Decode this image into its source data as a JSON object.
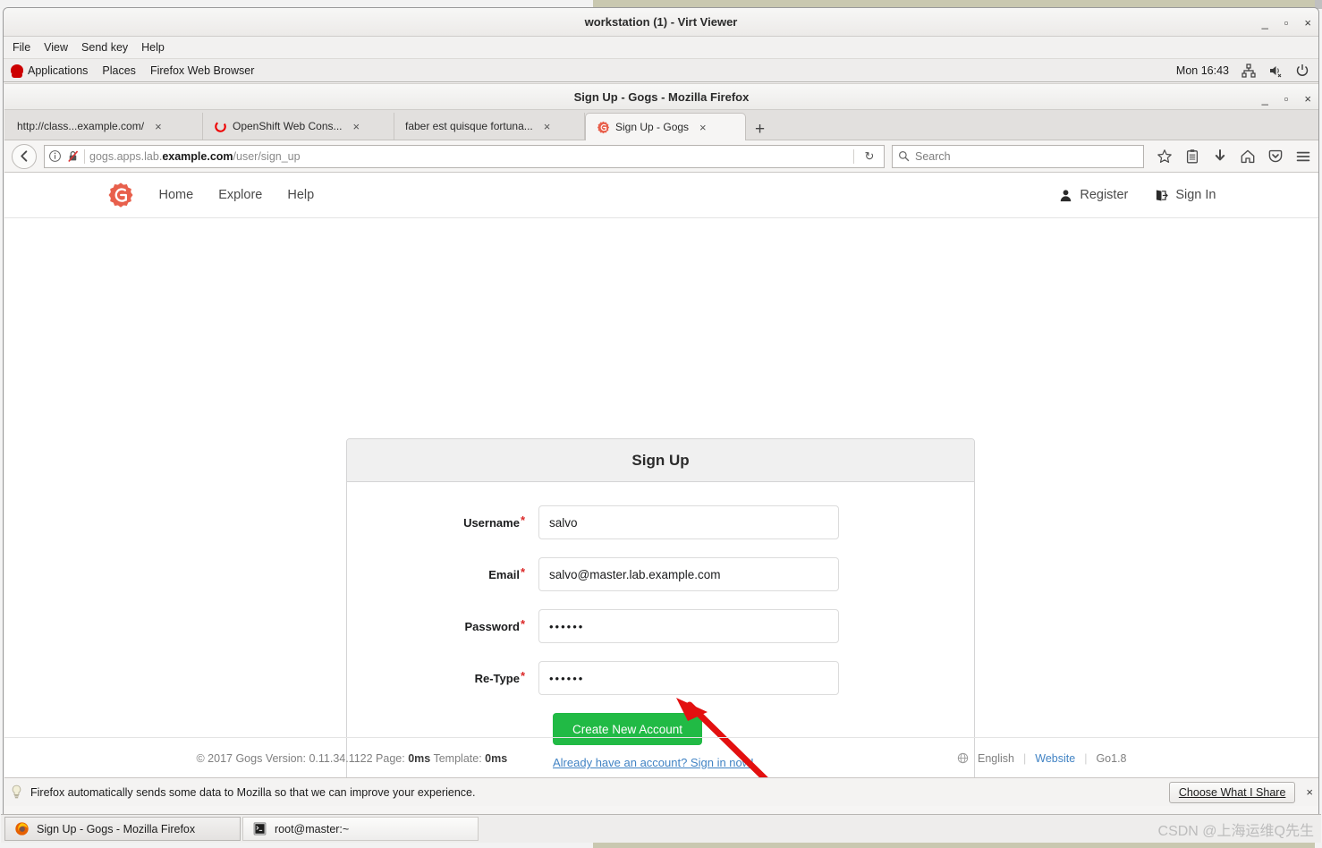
{
  "virt_viewer": {
    "title": "workstation (1) - Virt Viewer",
    "menu": [
      "File",
      "View",
      "Send key",
      "Help"
    ],
    "window_controls": {
      "minimize": "_",
      "maximize": "▫",
      "close": "×"
    }
  },
  "gnome_panel": {
    "applications": "Applications",
    "places": "Places",
    "current_app": "Firefox Web Browser",
    "clock": "Mon 16:43",
    "tray": [
      "network-icon",
      "volume-muted-icon",
      "power-icon"
    ]
  },
  "firefox": {
    "title": "Sign Up - Gogs - Mozilla Firefox",
    "window_controls": {
      "minimize": "_",
      "maximize": "▫",
      "close": "×"
    },
    "tabs": [
      {
        "label": "http://class...example.com/",
        "favicon": "none",
        "active": false,
        "close": "×"
      },
      {
        "label": "OpenShift Web Cons...",
        "favicon": "openshift-icon",
        "active": false,
        "close": "×"
      },
      {
        "label": "faber est quisque fortuna...",
        "favicon": "none",
        "active": false,
        "close": "×"
      },
      {
        "label": "Sign Up - Gogs",
        "favicon": "gogs-icon",
        "active": true,
        "close": "×"
      }
    ],
    "new_tab_label": "+",
    "url": {
      "host_prefix": "gogs.apps.lab.",
      "host_bold": "example.com",
      "path": "/user/sign_up"
    },
    "search_placeholder": "Search",
    "toolbar_icons": [
      "bookmark-star-icon",
      "reading-list-icon",
      "downloads-icon",
      "home-icon",
      "pocket-icon",
      "hamburger-menu-icon"
    ],
    "reload_label": "↻",
    "back_label": "←"
  },
  "gogs": {
    "nav": {
      "logo": "gogs-logo-icon",
      "links": [
        "Home",
        "Explore",
        "Help"
      ],
      "register": "Register",
      "sign_in": "Sign In"
    },
    "signup": {
      "title": "Sign Up",
      "required_marker": "*",
      "fields": [
        {
          "label": "Username",
          "value": "salvo",
          "type": "text"
        },
        {
          "label": "Email",
          "value": "salvo@master.lab.example.com",
          "type": "text"
        },
        {
          "label": "Password",
          "value": "••••••",
          "type": "password"
        },
        {
          "label": "Re-Type",
          "value": "••••••",
          "type": "password"
        }
      ],
      "submit_label": "Create New Account",
      "signin_link": "Already have an account? Sign in now!",
      "button_color": "#21ba45",
      "link_color": "#4183c4"
    },
    "footer": {
      "copyright_prefix": "© 2017 Gogs Version: 0.11.34.1122 Page: ",
      "page_time": "0ms",
      "template_prefix": " Template: ",
      "template_time": "0ms",
      "language": "English",
      "website": "Website",
      "go_version": "Go1.8"
    }
  },
  "notification": {
    "icon": "lightbulb-icon",
    "text": "Firefox automatically sends some data to Mozilla so that we can improve your experience.",
    "button": "Choose What I Share",
    "close": "×"
  },
  "taskbar": {
    "items": [
      {
        "label": "Sign Up - Gogs - Mozilla Firefox",
        "icon": "firefox-icon",
        "active": true
      },
      {
        "label": "root@master:~",
        "icon": "terminal-icon",
        "active": false
      }
    ],
    "watermark": "CSDN @上海运维Q先生"
  }
}
